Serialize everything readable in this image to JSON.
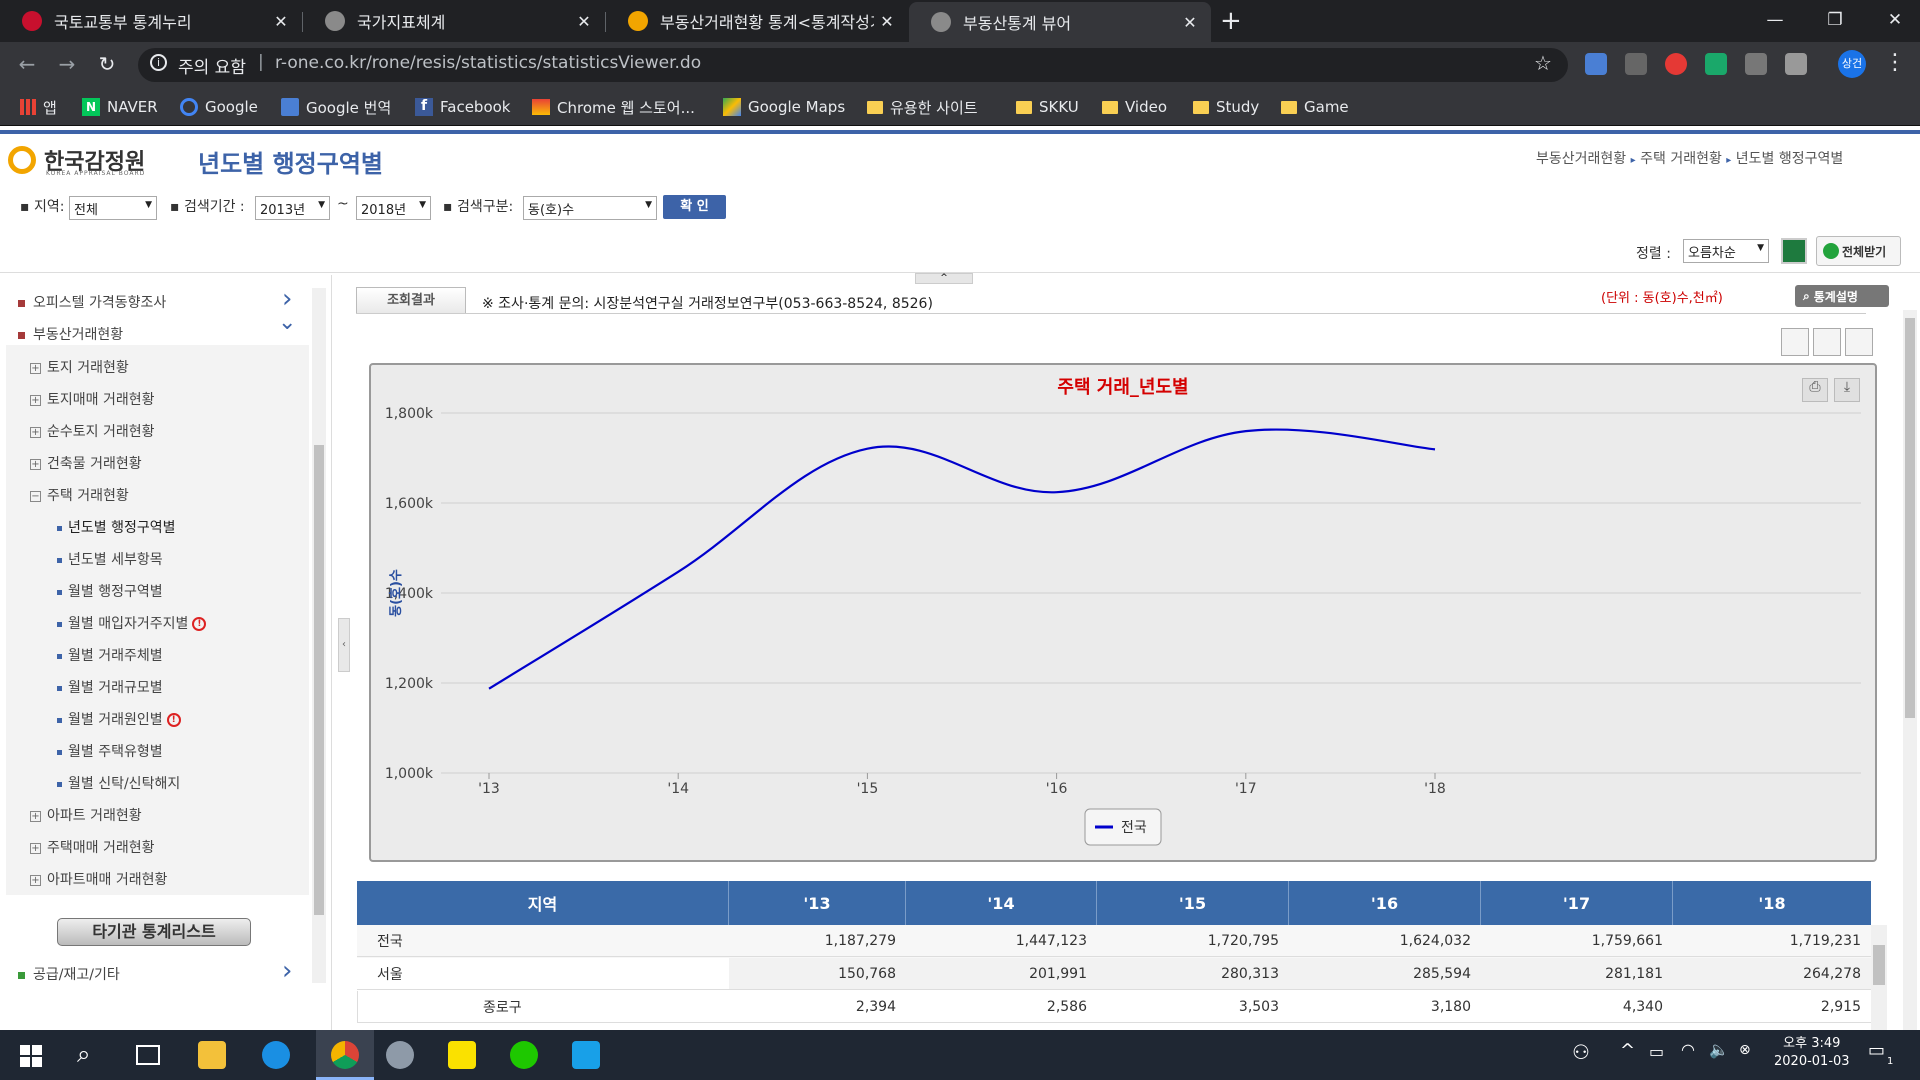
{
  "browser": {
    "tabs": [
      {
        "title": "국토교통부 통계누리",
        "favicon_color": "#c8102e"
      },
      {
        "title": "국가지표체계",
        "favicon_color": "#8a8a8a"
      },
      {
        "title": "부동산거래현황 통계<통계작성기",
        "favicon_color": "#f2a500"
      },
      {
        "title": "부동산통계 뷰어",
        "favicon_color": "#8a8a8a"
      }
    ],
    "new_tab": "+",
    "close_glyph": "✕",
    "address": {
      "security": "주의 요함",
      "sep": "|",
      "url": "r-one.co.kr/rone/resis/statistics/statisticsViewer.do"
    },
    "profile": "상건",
    "bookmarks": [
      "앱",
      "NAVER",
      "Google",
      "Google 번역",
      "Facebook",
      "Chrome 웹 스토어...",
      "Google Maps",
      "유용한 사이트",
      "SKKU",
      "Video",
      "Study",
      "Game"
    ]
  },
  "page": {
    "logo": {
      "main": "한국감정원",
      "sub": "KOREA APPRAISAL BOARD"
    },
    "title": "년도별 행정구역별",
    "breadcrumb": [
      "부동산거래현황",
      "주택 거래현황",
      "년도별 행정구역별"
    ],
    "filters": {
      "region_label": "지역:",
      "region_value": "전체",
      "period_label": "검색기간 :",
      "period_from": "2013년",
      "period_sep": "~",
      "period_to": "2018년",
      "type_label": "검색구분:",
      "type_value": "동(호)수",
      "confirm": "확 인"
    },
    "sort_label": "정렬 :",
    "sort_value": "오름차순",
    "download_all": "전체받기",
    "result_tab": "조회결과",
    "contact": "※ 조사·통계 문의: 시장분석연구실 거래정보연구부(053-663-8524, 8526)",
    "unit": "(단위 : 동(호)수,천㎡)",
    "stat_desc": "통계설명"
  },
  "sidebar": {
    "top_items": [
      {
        "label": "오피스텔 가격동향조사",
        "chevron": "›"
      },
      {
        "label": "부동산거래현황",
        "chevron": "⌄"
      }
    ],
    "tree": [
      {
        "label": "토지 거래현황",
        "box": "+"
      },
      {
        "label": "토지매매 거래현황",
        "box": "+"
      },
      {
        "label": "순수토지 거래현황",
        "box": "+"
      },
      {
        "label": "건축물 거래현황",
        "box": "+"
      },
      {
        "label": "주택 거래현황",
        "box": "−"
      }
    ],
    "subitems": [
      {
        "label": "년도별 행정구역별",
        "info": ""
      },
      {
        "label": "년도별 세부항목",
        "info": ""
      },
      {
        "label": "월별 행정구역별",
        "info": ""
      },
      {
        "label": "월별 매입자거주지별",
        "info": "!"
      },
      {
        "label": "월별 거래주체별",
        "info": ""
      },
      {
        "label": "월별 거래규모별",
        "info": ""
      },
      {
        "label": "월별 거래원인별",
        "info": "!"
      },
      {
        "label": "월별 주택유형별",
        "info": ""
      },
      {
        "label": "월별 신탁/신탁해지",
        "info": ""
      }
    ],
    "tree2": [
      {
        "label": "아파트 거래현황",
        "box": "+"
      },
      {
        "label": "주택매매 거래현황",
        "box": "+"
      },
      {
        "label": "아파트매매 거래현황",
        "box": "+"
      }
    ],
    "other_button": "타기관 통계리스트",
    "bottom_item": {
      "label": "공급/재고/기타",
      "chevron": "›"
    }
  },
  "chart_data": {
    "type": "line",
    "title": "주택 거래_년도별",
    "ylabel": "동(호)수",
    "categories": [
      "'13",
      "'14",
      "'15",
      "'16",
      "'17",
      "'18"
    ],
    "x_values": [
      2013,
      2014,
      2015,
      2016,
      2017,
      2018
    ],
    "yticks": [
      "1,000k",
      "1,200k",
      "1,400k",
      "1,600k",
      "1,800k"
    ],
    "ytick_values": [
      1000000,
      1200000,
      1400000,
      1600000,
      1800000
    ],
    "ylim": [
      1000000,
      1800000
    ],
    "series": [
      {
        "name": "전국",
        "color": "#0000cc",
        "values": [
          1187279,
          1447123,
          1720795,
          1624032,
          1759661,
          1719231
        ]
      }
    ],
    "grid": true,
    "legend": "bottom"
  },
  "table": {
    "headers": [
      "지역",
      "'13",
      "'14",
      "'15",
      "'16",
      "'17",
      "'18"
    ],
    "rows": [
      {
        "region": "전국",
        "indent": false,
        "values": [
          "1,187,279",
          "1,447,123",
          "1,720,795",
          "1,624,032",
          "1,759,661",
          "1,719,231"
        ]
      },
      {
        "region": "서울",
        "indent": false,
        "values": [
          "150,768",
          "201,991",
          "280,313",
          "285,594",
          "281,181",
          "264,278"
        ]
      },
      {
        "region": "종로구",
        "indent": true,
        "values": [
          "2,394",
          "2,586",
          "3,503",
          "3,180",
          "4,340",
          "2,915"
        ]
      }
    ]
  },
  "taskbar": {
    "clock_time": "오후 3:49",
    "clock_date": "2020-01-03",
    "notif_count": "1",
    "tray_up": "^"
  }
}
